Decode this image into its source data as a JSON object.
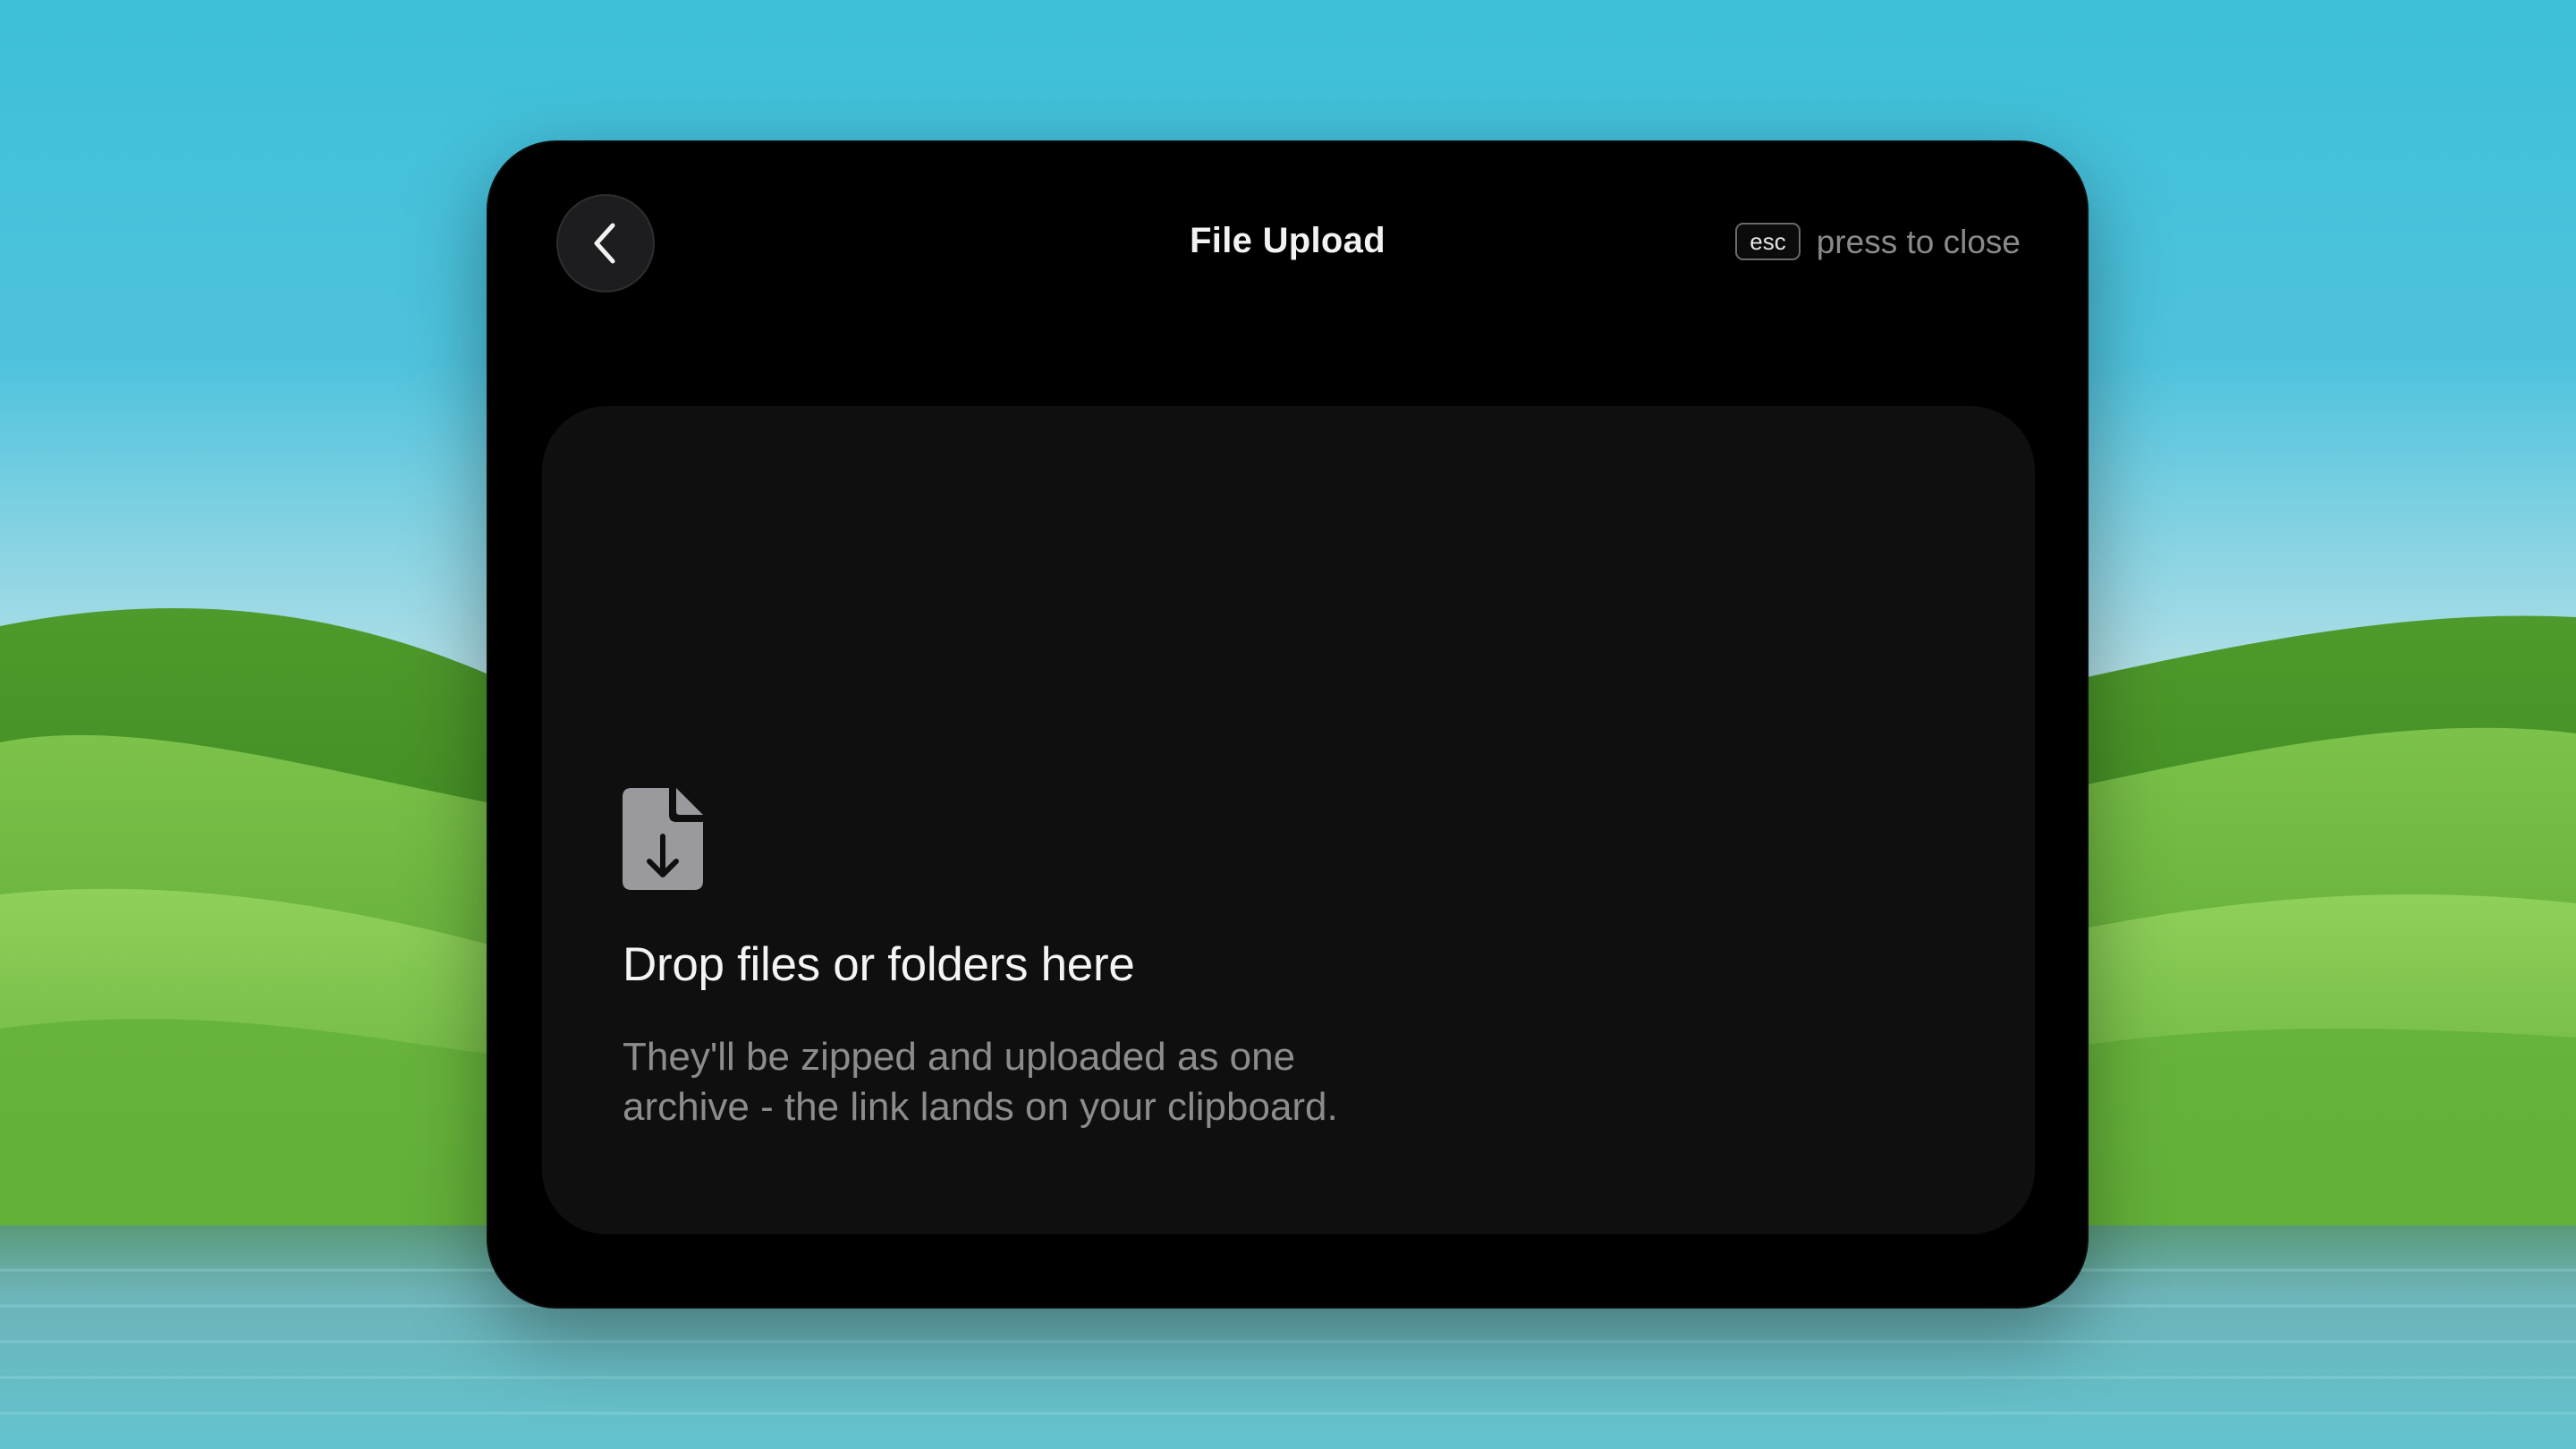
{
  "window": {
    "title": "File Upload"
  },
  "close_hint": {
    "key_label": "esc",
    "text": "press to close"
  },
  "drop_zone": {
    "title": "Drop files or folders here",
    "description": "They'll be zipped and uploaded as one archive - the link lands on your clipboard."
  },
  "icons": {
    "back": "chevron-left-icon",
    "file": "file-download-icon"
  },
  "colors": {
    "panel_bg": "#000000",
    "drop_zone_bg": "#0f0f0f",
    "title_text": "#f2f2f2",
    "muted_text": "#8a8a8a",
    "icon_gray": "#9a9a9e"
  }
}
